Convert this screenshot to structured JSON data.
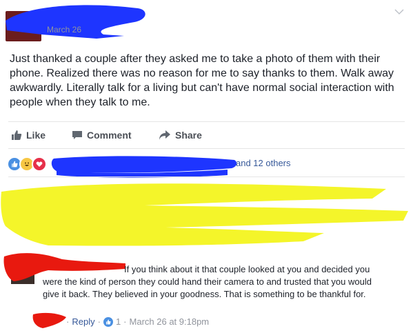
{
  "post": {
    "date_prefix": "March 26",
    "text": "Just thanked a couple after they asked me to take a photo of them with their phone. Realized there was no reason for me to say thanks to them. Walk away awkwardly. Literally talk for a living but can't have normal social interaction with people when they talk to me."
  },
  "actions": {
    "like_label": "Like",
    "comment_label": "Comment",
    "share_label": "Share"
  },
  "reactions": {
    "icons": [
      "like-icon",
      "haha-icon",
      "love-icon"
    ],
    "others_text": "and 12 others"
  },
  "reply": {
    "text": "If you think about it that couple looked at you and decided you were the kind of person they could hand their camera to and trusted that you would give it back. They believed in your goodness. That is something to be thankful for.",
    "reply_label": "Reply",
    "sep": "·",
    "like_count": "1",
    "timestamp": "March 26 at 9:18pm"
  },
  "colors": {
    "blue_redaction": "#1e35ff",
    "yellow_redaction": "#f4f52a",
    "red_redaction": "#e8190f",
    "link": "#365899"
  }
}
